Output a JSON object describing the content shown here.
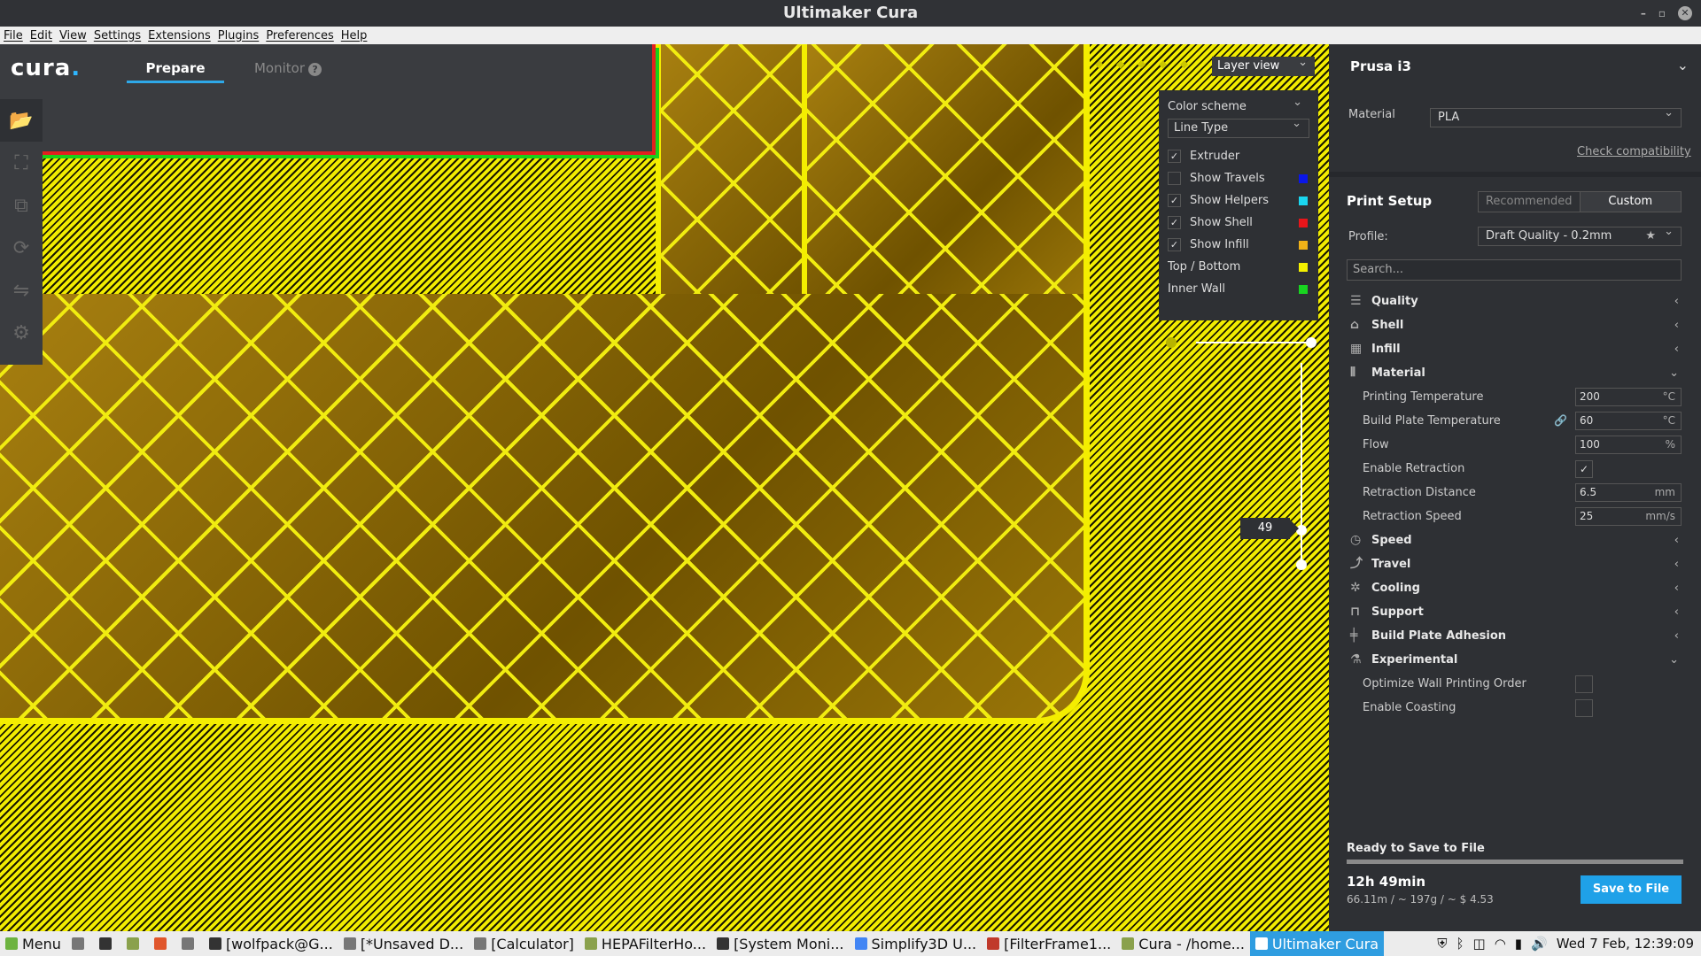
{
  "window": {
    "title": "Ultimaker Cura",
    "min": "–",
    "max": "▫",
    "close": "✕"
  },
  "menubar": [
    "File",
    "Edit",
    "View",
    "Settings",
    "Extensions",
    "Plugins",
    "Preferences",
    "Help"
  ],
  "header": {
    "logo": "cura",
    "tabs": [
      {
        "label": "Prepare",
        "active": true
      },
      {
        "label": "Monitor",
        "active": false
      }
    ],
    "monitor_help": "?"
  },
  "left_tools": [
    "open-file-icon",
    "translate-icon",
    "scale-icon",
    "rotate-icon",
    "mirror-icon",
    "per-model-settings-icon"
  ],
  "viewport": {
    "view_mode": "Layer view",
    "color_panel": {
      "title": "Color scheme",
      "scheme": "Line Type",
      "items": [
        {
          "label": "Extruder",
          "checked": true,
          "color": null
        },
        {
          "label": "Show Travels",
          "checked": false,
          "color": "#0a16e8"
        },
        {
          "label": "Show Helpers",
          "checked": true,
          "color": "#1ad6f0"
        },
        {
          "label": "Show Shell",
          "checked": true,
          "color": "#e8151a"
        },
        {
          "label": "Show Infill",
          "checked": true,
          "color": "#f0b218"
        },
        {
          "label": "Top / Bottom",
          "checked": null,
          "color": "#f4f000"
        },
        {
          "label": "Inner Wall",
          "checked": null,
          "color": "#18d420"
        }
      ]
    },
    "layer_number": "49"
  },
  "sidebar": {
    "printer": "Prusa i3",
    "material_label": "Material",
    "material_value": "PLA",
    "check_compat": "Check compatibility",
    "print_setup": "Print Setup",
    "modes": [
      {
        "label": "Recommended",
        "active": false
      },
      {
        "label": "Custom",
        "active": true
      }
    ],
    "profile_label": "Profile:",
    "profile_value": "Draft Quality - 0.2mm",
    "search_placeholder": "Search...",
    "categories": {
      "quality": "Quality",
      "shell": "Shell",
      "infill": "Infill",
      "material": "Material",
      "speed": "Speed",
      "travel": "Travel",
      "cooling": "Cooling",
      "support": "Support",
      "adhesion": "Build Plate Adhesion",
      "experimental": "Experimental"
    },
    "material_settings": [
      {
        "label": "Printing Temperature",
        "value": "200",
        "unit": "°C"
      },
      {
        "label": "Build Plate Temperature",
        "value": "60",
        "unit": "°C"
      },
      {
        "label": "Flow",
        "value": "100",
        "unit": "%"
      },
      {
        "label": "Enable Retraction",
        "checked": true
      },
      {
        "label": "Retraction Distance",
        "value": "6.5",
        "unit": "mm"
      },
      {
        "label": "Retraction Speed",
        "value": "25",
        "unit": "mm/s"
      }
    ],
    "experimental_settings": [
      {
        "label": "Optimize Wall Printing Order",
        "checked": false
      },
      {
        "label": "Enable Coasting",
        "checked": false
      }
    ],
    "save": {
      "status": "Ready to Save to File",
      "progress": 1.0,
      "time": "12h 49min",
      "usage": "66.11m / ~ 197g / ~ $ 4.53",
      "button": "Save to File"
    }
  },
  "taskbar": {
    "menu": "Menu",
    "windows": [
      {
        "label": "[wolfpack@G...",
        "active": false
      },
      {
        "label": "[*Unsaved D...",
        "active": false
      },
      {
        "label": "[Calculator]",
        "active": false
      },
      {
        "label": "HEPAFilterHo...",
        "active": false
      },
      {
        "label": "[System Moni...",
        "active": false
      },
      {
        "label": "Simplify3D U...",
        "active": false
      },
      {
        "label": "[FilterFrame1...",
        "active": false
      },
      {
        "label": "Cura - /home...",
        "active": false
      },
      {
        "label": "Ultimaker Cura",
        "active": true
      }
    ],
    "clock": "Wed  7 Feb, 12:39:09"
  }
}
